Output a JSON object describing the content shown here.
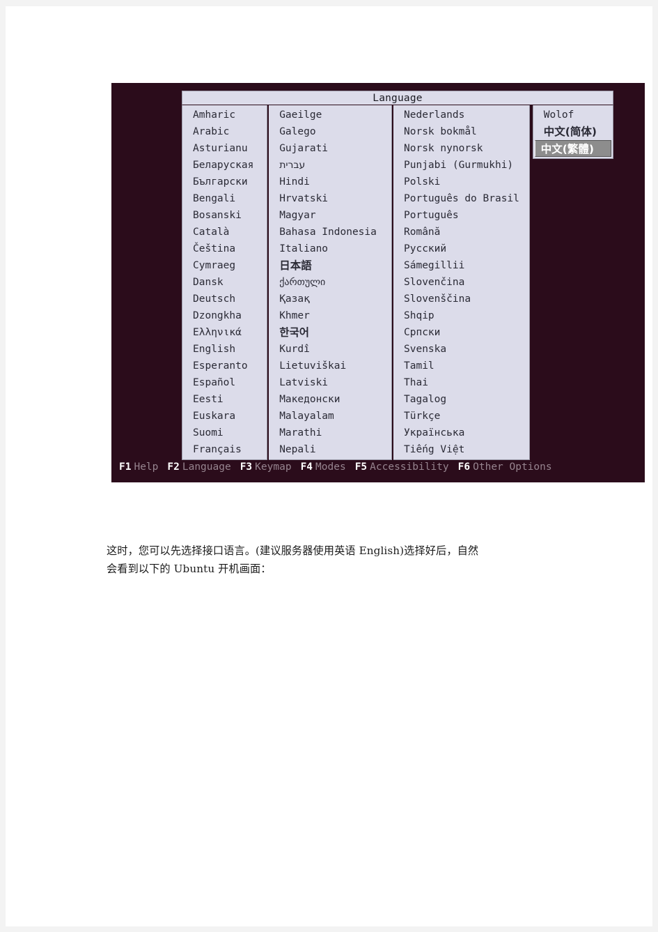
{
  "document": {
    "caption_line1": "这时，您可以先选择接口语言。(建议服务器使用英语 English)选择好后，自然",
    "caption_line2": "会看到以下的 Ubuntu 开机画面："
  },
  "terminal": {
    "background_color": "#2b0c1b",
    "panel_color": "#dcdcea",
    "highlight_color": "#8d8d8d",
    "dialog": {
      "title": "Language",
      "columns": [
        {
          "id": "column-1",
          "items": [
            {
              "label": "Amharic",
              "selected": false
            },
            {
              "label": "Arabic",
              "selected": false
            },
            {
              "label": "Asturianu",
              "selected": false
            },
            {
              "label": "Беларуская",
              "selected": false
            },
            {
              "label": "Български",
              "selected": false
            },
            {
              "label": "Bengali",
              "selected": false
            },
            {
              "label": "Bosanski",
              "selected": false
            },
            {
              "label": "Català",
              "selected": false
            },
            {
              "label": "Čeština",
              "selected": false
            },
            {
              "label": "Cymraeg",
              "selected": false
            },
            {
              "label": "Dansk",
              "selected": false
            },
            {
              "label": "Deutsch",
              "selected": false
            },
            {
              "label": "Dzongkha",
              "selected": false
            },
            {
              "label": "Ελληνικά",
              "selected": false
            },
            {
              "label": "English",
              "selected": false
            },
            {
              "label": "Esperanto",
              "selected": false
            },
            {
              "label": "Español",
              "selected": false
            },
            {
              "label": "Eesti",
              "selected": false
            },
            {
              "label": "Euskara",
              "selected": false
            },
            {
              "label": "Suomi",
              "selected": false
            },
            {
              "label": "Français",
              "selected": false
            }
          ]
        },
        {
          "id": "column-2",
          "items": [
            {
              "label": "Gaeilge",
              "selected": false
            },
            {
              "label": "Galego",
              "selected": false
            },
            {
              "label": "Gujarati",
              "selected": false
            },
            {
              "label": "עברית",
              "selected": false,
              "script": true
            },
            {
              "label": "Hindi",
              "selected": false
            },
            {
              "label": "Hrvatski",
              "selected": false
            },
            {
              "label": "Magyar",
              "selected": false
            },
            {
              "label": "Bahasa Indonesia",
              "selected": false
            },
            {
              "label": "Italiano",
              "selected": false
            },
            {
              "label": "日本語",
              "selected": false,
              "cjk": true
            },
            {
              "label": "ქართული",
              "selected": false,
              "script": true
            },
            {
              "label": "Қазақ",
              "selected": false
            },
            {
              "label": "Khmer",
              "selected": false
            },
            {
              "label": "한국어",
              "selected": false,
              "cjk": true
            },
            {
              "label": "Kurdî",
              "selected": false
            },
            {
              "label": "Lietuviškai",
              "selected": false
            },
            {
              "label": "Latviski",
              "selected": false
            },
            {
              "label": "Македонски",
              "selected": false
            },
            {
              "label": "Malayalam",
              "selected": false
            },
            {
              "label": "Marathi",
              "selected": false
            },
            {
              "label": "Nepali",
              "selected": false
            }
          ]
        },
        {
          "id": "column-3",
          "items": [
            {
              "label": "Nederlands",
              "selected": false
            },
            {
              "label": "Norsk bokmål",
              "selected": false
            },
            {
              "label": "Norsk nynorsk",
              "selected": false
            },
            {
              "label": "Punjabi (Gurmukhi)",
              "selected": false
            },
            {
              "label": "Polski",
              "selected": false
            },
            {
              "label": "Português do Brasil",
              "selected": false
            },
            {
              "label": "Português",
              "selected": false
            },
            {
              "label": "Română",
              "selected": false
            },
            {
              "label": "Русский",
              "selected": false
            },
            {
              "label": "Sámegillii",
              "selected": false
            },
            {
              "label": "Slovenčina",
              "selected": false
            },
            {
              "label": "Slovenščina",
              "selected": false
            },
            {
              "label": "Shqip",
              "selected": false
            },
            {
              "label": "Српски",
              "selected": false
            },
            {
              "label": "Svenska",
              "selected": false
            },
            {
              "label": "Tamil",
              "selected": false
            },
            {
              "label": "Thai",
              "selected": false
            },
            {
              "label": "Tagalog",
              "selected": false
            },
            {
              "label": "Türkçe",
              "selected": false
            },
            {
              "label": "Українська",
              "selected": false
            },
            {
              "label": "Tiếng Việt",
              "selected": false
            }
          ]
        },
        {
          "id": "column-4",
          "items": [
            {
              "label": "Wolof",
              "selected": false
            },
            {
              "label": "中文(简体)",
              "selected": false,
              "cjk": true
            },
            {
              "label": "中文(繁體)",
              "selected": true,
              "cjk": true
            }
          ]
        }
      ]
    },
    "function_keys": [
      {
        "key": "F1",
        "label": "Help"
      },
      {
        "key": "F2",
        "label": "Language"
      },
      {
        "key": "F3",
        "label": "Keymap"
      },
      {
        "key": "F4",
        "label": "Modes"
      },
      {
        "key": "F5",
        "label": "Accessibility"
      },
      {
        "key": "F6",
        "label": "Other Options"
      }
    ]
  }
}
